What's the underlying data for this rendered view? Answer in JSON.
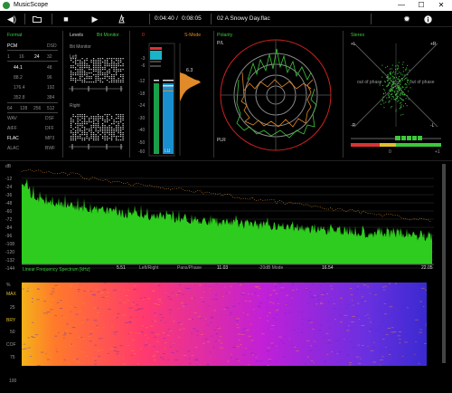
{
  "window": {
    "title": "MusicScope",
    "minimize": "—",
    "maximize": "☐",
    "close": "✕"
  },
  "toolbar": {
    "elapsed": "0:04:40",
    "separator": "/",
    "duration": "0:08:05",
    "track": "02 A Snowy Day.flac"
  },
  "icons": {
    "volume": "volume-icon",
    "folder": "folder-icon",
    "stop": "stop-icon",
    "play": "play-icon",
    "metronome": "metronome-icon",
    "settings": "gear-icon",
    "info": "info-icon"
  },
  "format": {
    "title": "Format",
    "pcm": "PCM",
    "dsd": "DSD",
    "bits": [
      "1",
      "16",
      "24",
      "32"
    ],
    "rates": [
      [
        "44.1",
        "48"
      ],
      [
        "88.2",
        "96"
      ],
      [
        "176.4",
        "192"
      ],
      [
        "352.8",
        "384"
      ]
    ],
    "dsd_rates": [
      "64",
      "128",
      "256",
      "512"
    ],
    "types": [
      [
        "WAV",
        "DSF"
      ],
      [
        "AIFF",
        "DFF"
      ],
      [
        "FLAC",
        "MP3"
      ],
      [
        "ALAC",
        "BWF"
      ]
    ]
  },
  "levels": {
    "title": "Levels",
    "mode": "Bit Monitor",
    "left": "Left",
    "right": "Right"
  },
  "meter": {
    "peak_top": "0",
    "scale": [
      "-3",
      "-6",
      "-12",
      "-18",
      "-24",
      "-30",
      "-40",
      "-50",
      "-60"
    ],
    "smode": "S-Mode",
    "hist_value": "6.3",
    "lu": "LU"
  },
  "polarity": {
    "title": "Polarity",
    "pl": "P/L",
    "plr": "PLR"
  },
  "stereo": {
    "title": "Stereo",
    "plus_l": "+L",
    "plus_r": "+R",
    "minus_l": "-R",
    "minus_r": "-L",
    "out_phase_1": "out of phase",
    "out_phase_2": "out of phase",
    "zero": "0",
    "plus1": "+1"
  },
  "spectrum": {
    "db": "dB",
    "ticks": [
      "0",
      "-12",
      "-24",
      "-36",
      "-48",
      "-60",
      "-72",
      "-84",
      "-96",
      "-108",
      "-120",
      "-132",
      "-144"
    ],
    "label": "Linear Frequency Spectrum [kHz]",
    "f1": "5.51",
    "f2": "11.03",
    "f3": "16.54",
    "f4": "22.05",
    "left_right": "Left/Right",
    "pans": "Pans/Phase",
    "mode": "-20dB Mode"
  },
  "spectrogram": {
    "percent": "%",
    "max": "MAX",
    "brt": "BRY",
    "cof": "COF",
    "ticks": [
      "0",
      "25",
      "50",
      "75",
      "100"
    ]
  },
  "colors": {
    "green": "#3cc83c",
    "orange": "#e08a2a",
    "red": "#d33",
    "spec_green": "#2ecc1e",
    "accent": "#00ff00"
  }
}
